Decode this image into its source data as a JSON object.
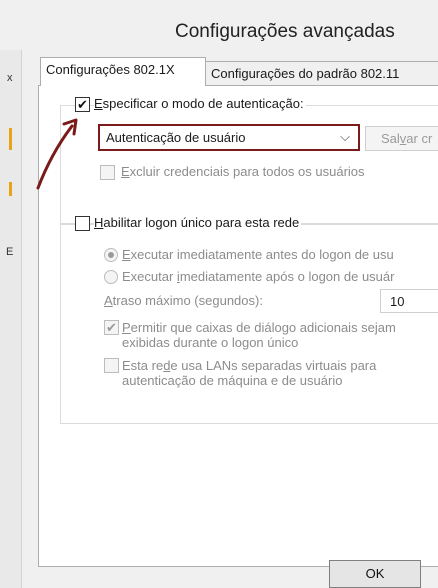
{
  "window": {
    "title": "Configurações avançadas"
  },
  "left_strip": {
    "chars": [
      "x",
      "E"
    ]
  },
  "tabs": [
    {
      "label": "Configurações 802.1X",
      "active": true
    },
    {
      "label": "Configurações do padrão 802.11",
      "active": false
    }
  ],
  "auth": {
    "checkbox_label_pre": "",
    "checkbox_label_u": "E",
    "checkbox_label_post": "specificar o modo de autenticação:",
    "checked": true,
    "mode_value": "Autenticação de usuário",
    "save_pre": "Sal",
    "save_u": "v",
    "save_post": "ar cr",
    "exclude_pre": "",
    "exclude_u": "E",
    "exclude_post": "xcluir credenciais para todos os usuários"
  },
  "sso": {
    "checkbox_label_pre": "",
    "checkbox_label_u": "H",
    "checkbox_label_post": "abilitar logon único para esta rede",
    "radio_before_pre": "",
    "radio_before_u": "E",
    "radio_before_post": "xecutar imediatamente antes do logon de usu",
    "radio_after_pre": "Executar ",
    "radio_after_u": "i",
    "radio_after_post": "mediatamente após o logon de usuár",
    "delay_pre": "",
    "delay_u": "A",
    "delay_post": "traso máximo (segundos):",
    "delay_value": "10",
    "allow_dialogs_pre": "",
    "allow_dialogs_u": "P",
    "allow_dialogs_post": "ermitir que caixas de diálogo adicionais sejam exibidas durante o logon único",
    "vlan_pre": "Esta re",
    "vlan_u": "d",
    "vlan_post": "e usa LANs separadas virtuais para autenticação de máquina e de usuário"
  },
  "footer": {
    "ok_label": "OK"
  },
  "colors": {
    "annotation_red": "#7a1a1a",
    "highlight_border": "#7a1a1a",
    "strip_marker": "#e8a317"
  }
}
